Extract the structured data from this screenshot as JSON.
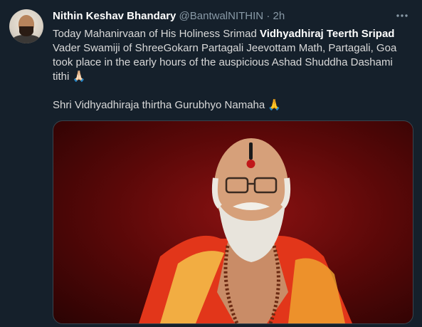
{
  "tweet": {
    "author_name": "Nithin Keshav Bhandary",
    "handle": "@BantwalNITHIN",
    "separator": "·",
    "time": "2h",
    "more_icon": "more-dots-icon",
    "text": {
      "line1_prefix": "Today Mahanirvaan of His Holiness Srimad ",
      "line1_bold": "Vidhyadhiraj Teerth Sripad",
      "line1_rest": " Vader Swamiji of ShreeGokarn Partagali Jeevottam Math, Partagali, Goa took place in the early hours of the auspicious Ashad Shuddha Dashami tithi",
      "emoji1": "🙏🏻",
      "line2": "Shri Vidhyadhiraja thirtha Gurubhyo Namaha",
      "emoji2": "🙏"
    },
    "media": {
      "type": "photo"
    }
  },
  "colors": {
    "background": "#15202b",
    "primary_text": "#d9d9d9",
    "name_text": "#ffffff",
    "secondary_text": "#8899a6",
    "border": "#38444d"
  }
}
